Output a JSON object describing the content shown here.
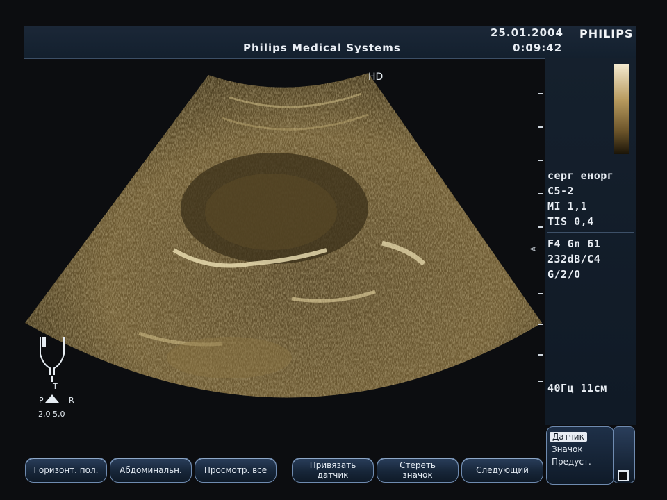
{
  "header": {
    "system": "Philips Medical Systems",
    "date": "25.01.2004",
    "time": "0:09:42",
    "brand": "PHILIPS"
  },
  "image": {
    "mode_label": "HD"
  },
  "params": {
    "preset": "серг енорг",
    "probe": "С5-2",
    "mi": "MI 1,1",
    "tis": "TIS 0,4",
    "line1": "F4    Gn 61",
    "line2": "232dB/C4",
    "line3": "G/2/0",
    "freq_depth": "40Гц   11см"
  },
  "orientation": {
    "t_label": "T",
    "p_label": "P",
    "r_label": "R",
    "values": "2,0 5,0"
  },
  "softkeys": [
    {
      "label": "Горизонт. пол."
    },
    {
      "label": "Абдоминальн."
    },
    {
      "label": "Просмотр. все"
    },
    {
      "label": "Привязать\nдатчик"
    },
    {
      "label": "Стереть\nзначок"
    },
    {
      "label": "Следующий"
    }
  ],
  "menu": {
    "items": [
      "Датчик",
      "Значок",
      "Предуст."
    ],
    "selected": 0
  }
}
